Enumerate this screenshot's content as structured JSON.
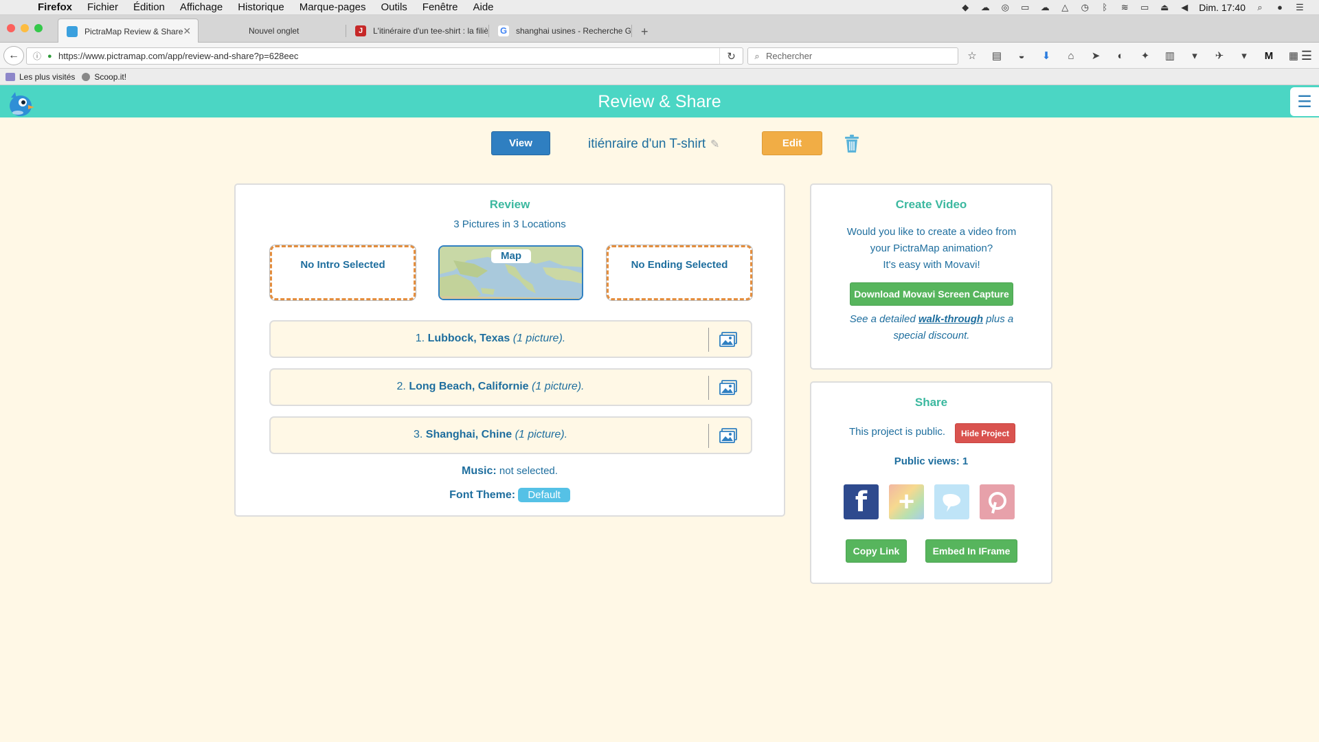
{
  "menubar": {
    "app": "Firefox",
    "items": [
      "Fichier",
      "Édition",
      "Affichage",
      "Historique",
      "Marque-pages",
      "Outils",
      "Fenêtre",
      "Aide"
    ],
    "clock": "Dim. 17:40"
  },
  "tabs": [
    {
      "label": "PictraMap Review & Share",
      "active": true
    },
    {
      "label": "Nouvel onglet",
      "active": false
    },
    {
      "label": "L'itinéraire d'un tee-shirt : la filiè",
      "active": false
    },
    {
      "label": "shanghai usines - Recherche Goo",
      "active": false
    }
  ],
  "url": "https://www.pictramap.com/app/review-and-share?p=628eec",
  "search_placeholder": "Rechercher",
  "bookmarks": [
    "Les plus visités",
    "Scoop.it!"
  ],
  "app": {
    "title": "Review & Share",
    "view_label": "View",
    "project_name": "itiénraire d'un T-shirt",
    "edit_label": "Edit"
  },
  "review": {
    "title": "Review",
    "subtitle": "3 Pictures in 3 Locations",
    "intro": "No Intro Selected",
    "map_label": "Map",
    "ending": "No Ending Selected",
    "locations": [
      {
        "num": "1.",
        "name": "Lubbock, Texas",
        "count": "(1 picture)."
      },
      {
        "num": "2.",
        "name": "Long Beach, Californie",
        "count": "(1 picture)."
      },
      {
        "num": "3.",
        "name": "Shanghai, Chine",
        "count": "(1 picture)."
      }
    ],
    "music_label": "Music:",
    "music_value": "not selected.",
    "font_label": "Font Theme:",
    "font_value": "Default"
  },
  "video": {
    "title": "Create Video",
    "line1": "Would you like to create a video from",
    "line2": "your PictraMap animation?",
    "line3": "It's easy with Movavi!",
    "button": "Download Movavi Screen Capture",
    "walk_pre": "See a detailed",
    "walk_link": "walk-through",
    "walk_post1": "plus a",
    "walk_post2": "special discount."
  },
  "share": {
    "title": "Share",
    "status": "This project is public.",
    "hide_button": "Hide Project",
    "views": "Public views: 1",
    "copy_button": "Copy Link",
    "embed_button": "Embed In IFrame"
  },
  "colors": {
    "header": "#4bd6c4",
    "accent_blue": "#2f7fc1",
    "edit_orange": "#f1ad45",
    "green": "#57b55d",
    "red": "#d9534f"
  }
}
